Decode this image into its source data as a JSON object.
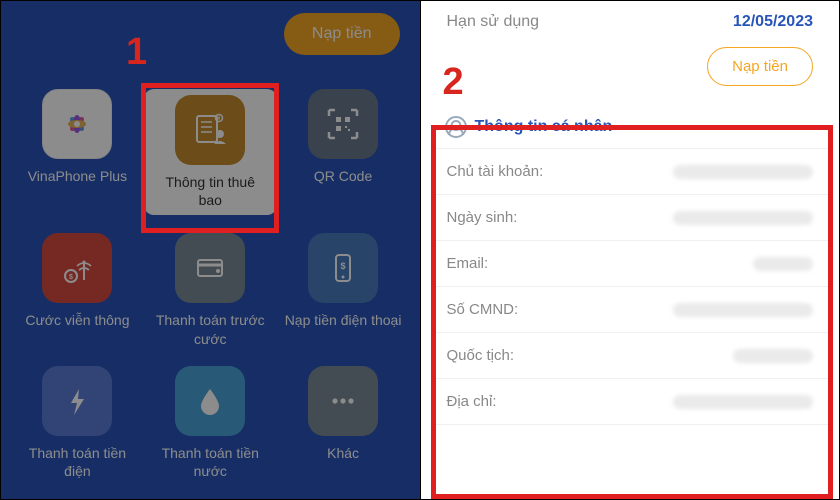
{
  "step1_marker": "1",
  "step2_marker": "2",
  "topup_button": "Nạp tiền",
  "grid": {
    "vinaphone_plus": "VinaPhone Plus",
    "subscriber_info": "Thông tin thuê bao",
    "qr_code": "QR Code",
    "telecom_fee": "Cước viễn thông",
    "prepay": "Thanh toán trước cước",
    "phone_topup": "Nạp tiền điện thoại",
    "electric_pay": "Thanh toán tiền điện",
    "water_pay": "Thanh toán tiền nước",
    "other": "Khác"
  },
  "right": {
    "expiry_label": "Hạn sử dụng",
    "expiry_date": "12/05/2023",
    "topup_button": "Nạp tiền",
    "info_header": "Thông tin cá nhân",
    "rows": {
      "owner": "Chủ tài khoản:",
      "birthday": "Ngày sinh:",
      "email": "Email:",
      "id_number": "Số CMND:",
      "nationality": "Quốc tịch:",
      "address": "Địa chỉ:"
    }
  }
}
